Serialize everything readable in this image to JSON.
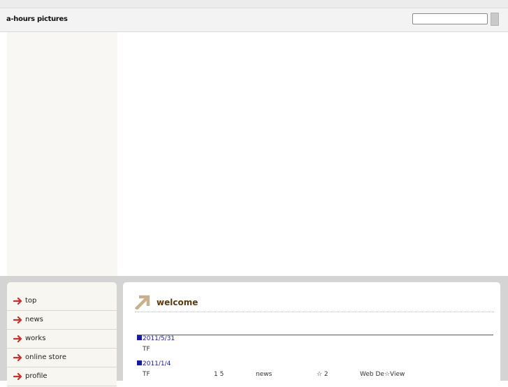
{
  "header": {
    "site_title": "a-hours pictures",
    "search_placeholder": ""
  },
  "nav": {
    "items": [
      {
        "label": "top"
      },
      {
        "label": "news"
      },
      {
        "label": "works"
      },
      {
        "label": "online store"
      },
      {
        "label": "profile"
      }
    ]
  },
  "content": {
    "welcome_title": "welcome",
    "news": [
      {
        "date": "2011/5/31",
        "text": [
          "TF"
        ]
      },
      {
        "date": "2011/1/4",
        "text": [
          "TF",
          "1 5",
          "news",
          "☆ 2",
          "Web De☆View"
        ]
      }
    ]
  },
  "colors": {
    "accent_arrow": "#c8302a",
    "welcome_arrow": "#c7b18f",
    "date_blue": "#1a1a9c",
    "title_brown": "#5a3a12"
  }
}
